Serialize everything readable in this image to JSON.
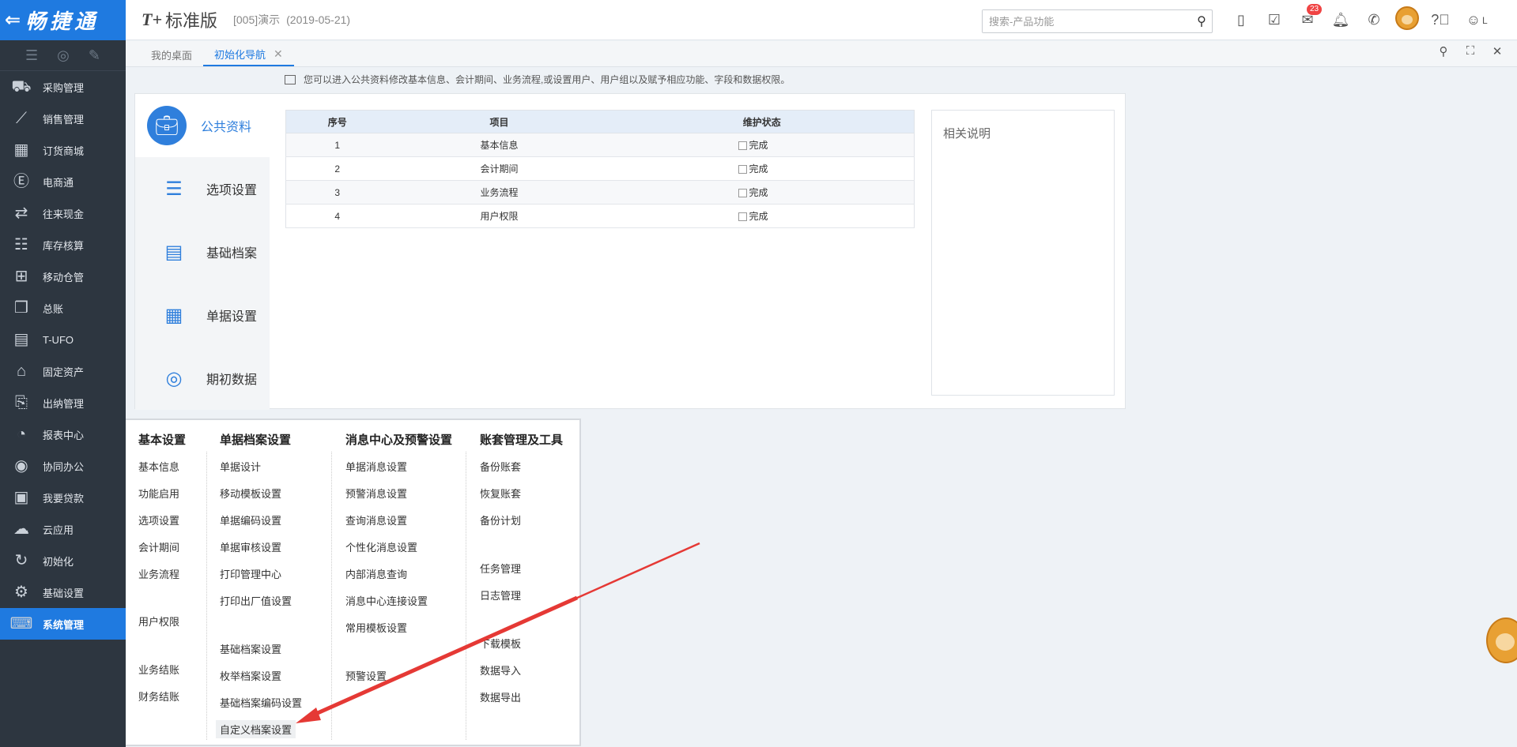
{
  "app": {
    "brand": "畅捷通",
    "logo": "T+",
    "product": "标准版",
    "account_code": "[005]演示",
    "account_date": "(2019-05-21)"
  },
  "header": {
    "search_placeholder": "搜索-产品功能",
    "message_badge": "23",
    "user_letter": "L"
  },
  "sidebar": {
    "items": [
      {
        "label": "采购管理",
        "icon": "cart-icon"
      },
      {
        "label": "销售管理",
        "icon": "chart-up-icon"
      },
      {
        "label": "订货商城",
        "icon": "store-icon"
      },
      {
        "label": "电商通",
        "icon": "ecommerce-icon"
      },
      {
        "label": "往来现金",
        "icon": "exchange-icon"
      },
      {
        "label": "库存核算",
        "icon": "warehouse-icon"
      },
      {
        "label": "移动仓管",
        "icon": "grid-icon"
      },
      {
        "label": "总账",
        "icon": "ledger-icon"
      },
      {
        "label": "T-UFO",
        "icon": "ufo-icon"
      },
      {
        "label": "固定资产",
        "icon": "bank-icon"
      },
      {
        "label": "出纳管理",
        "icon": "cashier-icon"
      },
      {
        "label": "报表中心",
        "icon": "pie-icon"
      },
      {
        "label": "协同办公",
        "icon": "target-icon"
      },
      {
        "label": "我要贷款",
        "icon": "money-icon"
      },
      {
        "label": "云应用",
        "icon": "cloud-icon"
      },
      {
        "label": "初始化",
        "icon": "refresh-icon"
      },
      {
        "label": "基础设置",
        "icon": "settings-icon"
      },
      {
        "label": "系统管理",
        "icon": "code-icon",
        "active": true
      }
    ]
  },
  "tabs": [
    {
      "label": "我的桌面",
      "active": false
    },
    {
      "label": "初始化导航",
      "active": true
    }
  ],
  "hint": "您可以进入公共资料修改基本信息、会计期间、业务流程,或设置用户、用户组以及赋予相应功能、字段和数据权限。",
  "nav": [
    {
      "label": "公共资料",
      "active": true
    },
    {
      "label": "选项设置"
    },
    {
      "label": "基础档案"
    },
    {
      "label": "单据设置"
    },
    {
      "label": "期初数据"
    }
  ],
  "grid": {
    "headers": {
      "seq": "序号",
      "item": "项目",
      "status": "维护状态"
    },
    "rows": [
      {
        "seq": "1",
        "item": "基本信息",
        "status": "完成"
      },
      {
        "seq": "2",
        "item": "会计期间",
        "status": "完成"
      },
      {
        "seq": "3",
        "item": "业务流程",
        "status": "完成"
      },
      {
        "seq": "4",
        "item": "用户权限",
        "status": "完成"
      }
    ]
  },
  "desc": {
    "title": "相关说明"
  },
  "popup": {
    "col1": {
      "header": "基本设置",
      "items": [
        "基本信息",
        "功能启用",
        "选项设置",
        "会计期间",
        "业务流程",
        "用户权限",
        "业务结账",
        "财务结账"
      ]
    },
    "col2": {
      "header": "单据档案设置",
      "items": [
        "单据设计",
        "移动模板设置",
        "单据编码设置",
        "单据审核设置",
        "打印管理中心",
        "打印出厂值设置",
        "基础档案设置",
        "枚举档案设置",
        "基础档案编码设置",
        "自定义档案设置"
      ]
    },
    "col3": {
      "header": "消息中心及预警设置",
      "items": [
        "单据消息设置",
        "预警消息设置",
        "查询消息设置",
        "个性化消息设置",
        "内部消息查询",
        "消息中心连接设置",
        "常用模板设置",
        "预警设置"
      ]
    },
    "col4": {
      "header": "账套管理及工具",
      "items": [
        "备份账套",
        "恢复账套",
        "备份计划",
        "任务管理",
        "日志管理",
        "下载模板",
        "数据导入",
        "数据导出"
      ]
    }
  },
  "colors": {
    "accent": "#1f7ae0",
    "sidebar_bg": "#2d3640",
    "annotation_arrow": "#e53935"
  }
}
